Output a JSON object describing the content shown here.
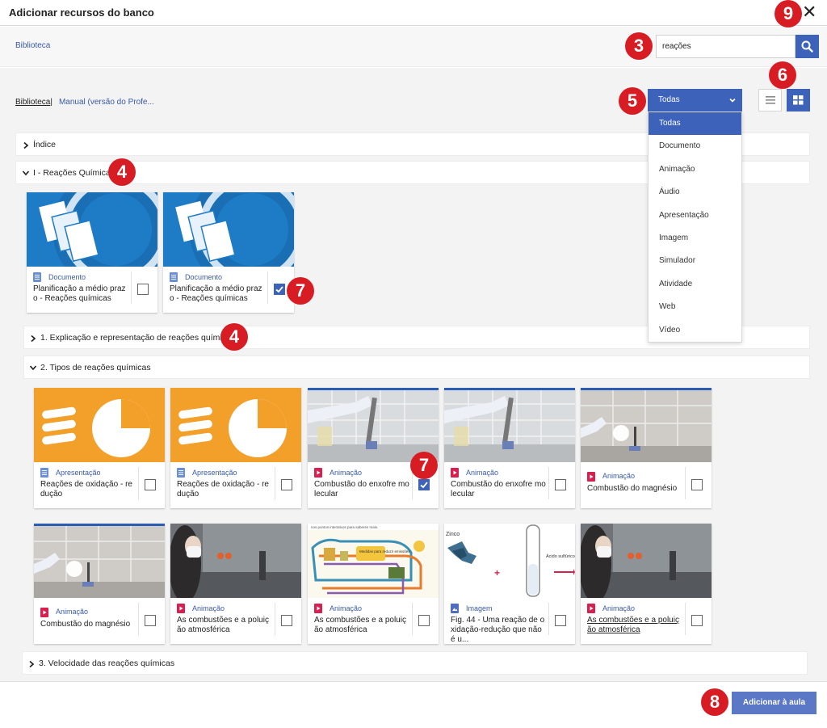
{
  "dialog": {
    "title": "Adicionar recursos do banco",
    "close_icon": "close-icon"
  },
  "search": {
    "tab": "Biblioteca",
    "value": "reações",
    "button_icon": "search-icon"
  },
  "breadcrumb": {
    "root": "Biblioteca",
    "separator": "|",
    "current": "Manual (versão do Profe..."
  },
  "filter": {
    "selected": "Todas",
    "options": [
      "Todas",
      "Documento",
      "Animação",
      "Áudio",
      "Apresentação",
      "Imagem",
      "Simulador",
      "Atividade",
      "Web",
      "Vídeo"
    ]
  },
  "view_modes": [
    "list-view",
    "grid-view"
  ],
  "sections": {
    "indice": "Índice",
    "reacoes": "I - Reações Químicas",
    "explicacao": "1. Explicação e representação de reações químicas",
    "tipos": "2. Tipos de reações químicas",
    "velocidade": "3. Velocidade das reações químicas"
  },
  "cards_reacoes": [
    {
      "type": "Documento",
      "name": "Planificação a médio prazo - Reações químicas",
      "checked": false
    },
    {
      "type": "Documento",
      "name": "Planificação a médio prazo - Reações químicas",
      "checked": true
    }
  ],
  "cards_tipos_row1": [
    {
      "type": "Apresentação",
      "name": "Reações de oxidação - redução",
      "checked": false
    },
    {
      "type": "Apresentação",
      "name": "Reações de oxidação - redução",
      "checked": false
    },
    {
      "type": "Animação",
      "name": "Combustão do enxofre molecular",
      "checked": true
    },
    {
      "type": "Animação",
      "name": "Combustão do enxofre molecular",
      "checked": false
    },
    {
      "type": "Animação",
      "name": "Combustão do magnésio",
      "checked": false
    }
  ],
  "cards_tipos_row2": [
    {
      "type": "Animação",
      "name": "Combustão do magnésio",
      "checked": false
    },
    {
      "type": "Animação",
      "name": "As combustões e a poluição atmosférica",
      "checked": false
    },
    {
      "type": "Animação",
      "name": "As combustões e a poluição atmosférica",
      "checked": false
    },
    {
      "type": "Imagem",
      "name": "Fig. 44 - Uma reação de oxidação-redução que não é u...",
      "checked": false
    },
    {
      "type": "Animação",
      "name": "As combustões e a poluição atmosférica",
      "checked": false
    }
  ],
  "thumb_text": {
    "zinco": "Zinco",
    "acido": "Ácido sulfúrico",
    "plus": "+",
    "info_header": "nos pontos interativos para saberes mais.",
    "info_box": "Medidas para reduzir emissões"
  },
  "footer": {
    "add_button": "Adicionar à aula"
  },
  "callouts": [
    "9",
    "3",
    "6",
    "5",
    "4",
    "7",
    "4",
    "7",
    "8"
  ],
  "colors": {
    "primary": "#3d62b9",
    "badge": "#d71c24",
    "link": "#3a5aa8"
  }
}
